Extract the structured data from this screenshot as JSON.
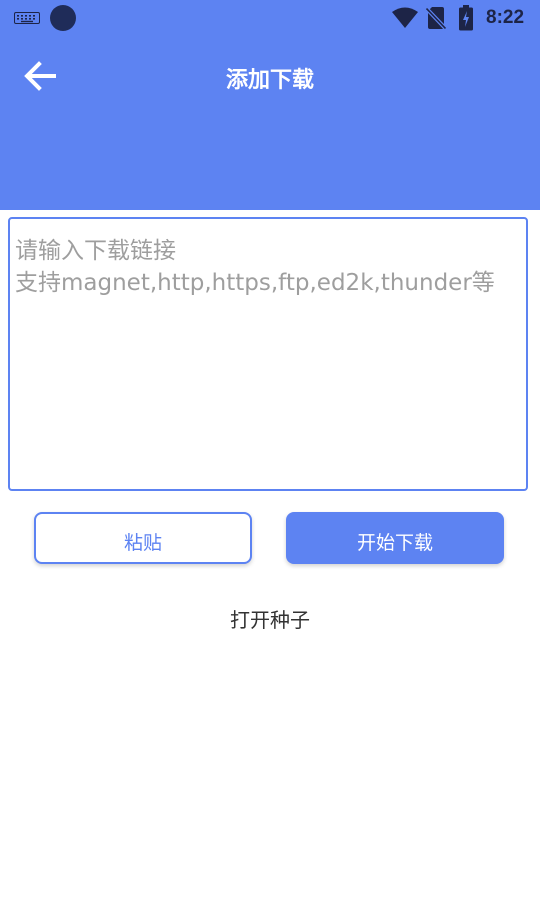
{
  "status_bar": {
    "time": "8:22",
    "icons": [
      "keyboard-icon",
      "notification-dot-icon",
      "wifi-icon",
      "no-sim-icon",
      "battery-icon"
    ]
  },
  "header": {
    "title": "添加下载",
    "back_icon": "arrow-left-icon"
  },
  "link_input": {
    "placeholder": "请输入下载链接\n支持magnet,http,https,ftp,ed2k,thunder等",
    "value": ""
  },
  "buttons": {
    "paste_label": "粘贴",
    "start_label": "开始下载"
  },
  "open_torrent_label": "打开种子",
  "colors": {
    "primary": "#5d83f2",
    "status_icons": "#1d2447",
    "placeholder": "#9e9e9e",
    "text": "#333333",
    "background": "#ffffff"
  }
}
